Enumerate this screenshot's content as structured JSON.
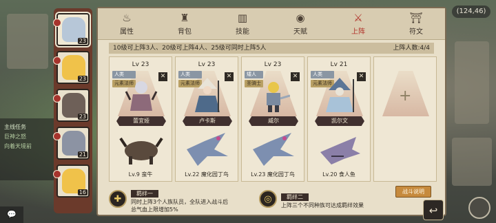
{
  "coords": "(124,46)",
  "quest": {
    "title": "主线任务",
    "line1": "巨神之怒",
    "line2": "向着天境前"
  },
  "roster": [
    {
      "level": "23",
      "face": "#b7c7d8"
    },
    {
      "level": "23",
      "face": "#f0c24a"
    },
    {
      "level": "23",
      "face": "#6e6058"
    },
    {
      "level": "21",
      "face": "#8c93a3"
    },
    {
      "level": "16",
      "face": "#f0c24a"
    }
  ],
  "tabs": [
    {
      "label": "属性",
      "icon": "flame-icon"
    },
    {
      "label": "背包",
      "icon": "bag-icon"
    },
    {
      "label": "技能",
      "icon": "book-icon"
    },
    {
      "label": "天赋",
      "icon": "eye-icon"
    },
    {
      "label": "上阵",
      "icon": "crossed-swords-icon",
      "active": true
    },
    {
      "label": "符文",
      "icon": "rune-icon"
    }
  ],
  "info": {
    "rule": "10级可上阵3人、20级可上阵4人、25级可同时上阵5人",
    "count": "上阵人数:4/4"
  },
  "cards": [
    {
      "lv": "Lv 23",
      "race": "人类",
      "role": "元素法师",
      "name": "蕾宜娅",
      "mount": "Lv.9 蛮牛",
      "hero_color": "#b8b8c4",
      "mount_color": "#5a4a3d"
    },
    {
      "lv": "Lv 23",
      "race": "人类",
      "role": "元素法师",
      "name": "卢卡斯",
      "mount": "Lv.22 魔化园丁鸟",
      "hero_color": "#4e6a8a",
      "mount_color": "#7d8fb0"
    },
    {
      "lv": "Lv 23",
      "race": "矮人",
      "role": "圣骑士",
      "name": "威尔",
      "mount": "Lv.23 魔化园丁鸟",
      "hero_color": "#e8c64a",
      "mount_color": "#7d8fb0"
    },
    {
      "lv": "Lv 21",
      "race": "人类",
      "role": "元素法师",
      "name": "凯尔文",
      "mount": "Lv.20 食人鱼",
      "hero_color": "#7a8ca8",
      "mount_color": "#8b7fa8"
    }
  ],
  "bonds": [
    {
      "title": "羁绊一",
      "text1": "同时上阵3个人族队员，全队进入战斗后",
      "text2": "总气血上限增加5%"
    },
    {
      "title": "羁绊二",
      "text1": "上阵三个不同种族可达成羁绊效果",
      "text2": ""
    }
  ],
  "explain_label": "战斗说明",
  "back_label": "↩",
  "chat_label": "💬"
}
